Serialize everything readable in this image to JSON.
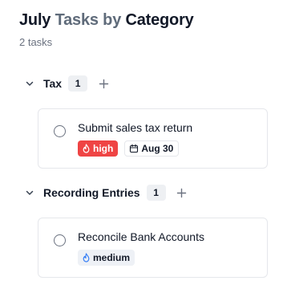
{
  "header": {
    "title_parts": [
      "July",
      "Tasks by",
      "Category"
    ],
    "subtitle": "2 tasks"
  },
  "groups": [
    {
      "name": "Tax",
      "count": "1",
      "tasks": [
        {
          "title": "Submit sales tax return",
          "priority": "high",
          "due": "Aug 30"
        }
      ]
    },
    {
      "name": "Recording Entries",
      "count": "1",
      "tasks": [
        {
          "title": "Reconcile Bank Accounts",
          "priority": "medium"
        }
      ]
    }
  ],
  "colors": {
    "priority_high": "#ef4444",
    "priority_medium_bg": "#eef1f6",
    "muted_title": "#5f6b7a"
  },
  "icons": {
    "group_toggle": "chevron-down-icon",
    "add": "plus-icon",
    "task_status": "circle-checkbox-icon",
    "priority": "flame-icon",
    "due_date": "calendar-icon"
  }
}
